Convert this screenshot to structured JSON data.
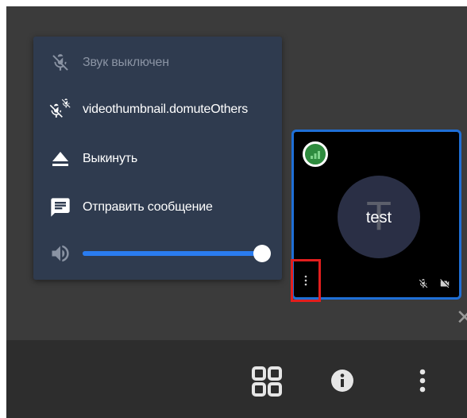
{
  "context_menu": {
    "mute": {
      "label": "Звук выключен",
      "icon": "mic-off-icon",
      "disabled": true
    },
    "mute_others": {
      "label": "videothumbnail.domuteOthers",
      "icon": "mute-others-icon"
    },
    "kick": {
      "label": "Выкинуть",
      "icon": "eject-icon"
    },
    "send_message": {
      "label": "Отправить сообщение",
      "icon": "message-icon"
    },
    "volume": {
      "icon": "volume-icon",
      "level": 1.0
    }
  },
  "thumbnail": {
    "avatar_letter": "T",
    "display_name": "test",
    "connection_icon": "signal-icon",
    "status_icons": [
      "mic-off-icon",
      "camera-off-icon"
    ],
    "menu_icon": "vertical-dots-icon"
  },
  "toolbar": {
    "grid_icon": "tile-view-icon",
    "info_icon": "info-icon",
    "more_icon": "more-vertical-icon"
  },
  "colors": {
    "stage": "#3b3b3b",
    "menu_bg": "#2f3b4f",
    "accent": "#1f6fd6",
    "highlight": "#e21e1e",
    "connection": "#2e8b3e"
  }
}
